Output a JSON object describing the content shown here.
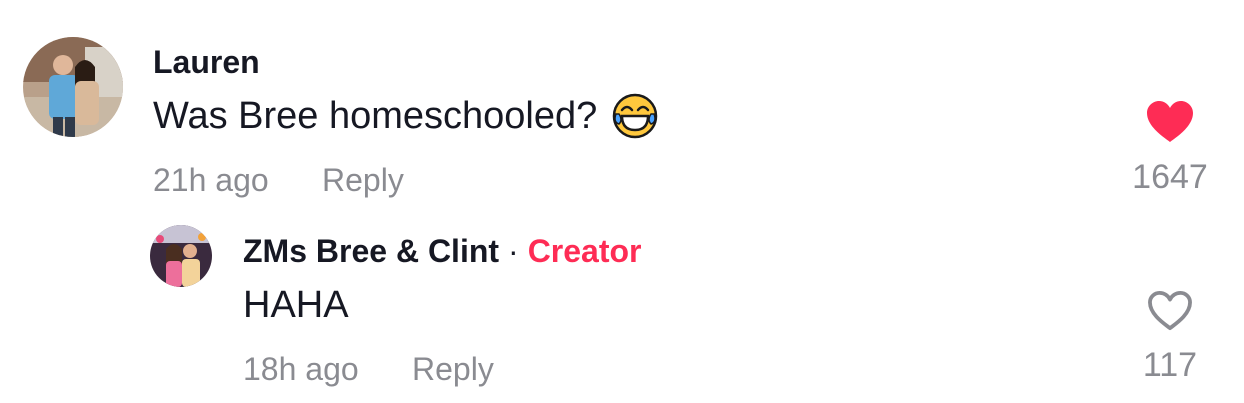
{
  "comment": {
    "username": "Lauren",
    "text": "Was Bree homeschooled?",
    "emoji_icon": "face-with-tears-of-joy-icon",
    "time": "21h ago",
    "reply_label": "Reply",
    "like_count": "1647",
    "liked": true
  },
  "reply": {
    "username": "ZMs Bree & Clint",
    "separator": "·",
    "badge": "Creator",
    "text": "HAHA",
    "time": "18h ago",
    "reply_label": "Reply",
    "like_count": "117",
    "liked": false
  },
  "colors": {
    "like_active": "#fe2c55",
    "creator_badge": "#fe2c55",
    "meta_text": "#8a8b91"
  }
}
